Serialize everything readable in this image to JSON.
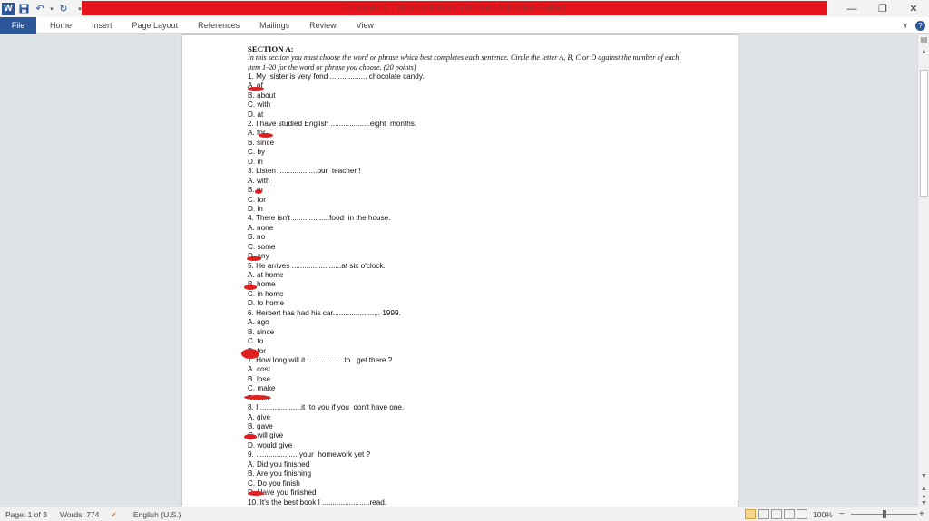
{
  "title_bar": {
    "title": "Document2 - Microsoft Word (Product Activation Failed)",
    "logo_letter": "W",
    "qat": {
      "save": "🖫",
      "undo": "↶",
      "redo": "↻",
      "customize": "▾"
    },
    "controls": {
      "minimize": "—",
      "restore": "❐",
      "close": "✕"
    }
  },
  "ribbon": {
    "tabs": [
      "File",
      "Home",
      "Insert",
      "Page Layout",
      "References",
      "Mailings",
      "Review",
      "View"
    ],
    "help": "?",
    "expand": "∨"
  },
  "document": {
    "heading": "SECTION A:",
    "instructions": "In this section you must choose the word or phrase which best completes each sentence. Circle the letter A, B, C or D against the number of each item 1-20 for the word or phrase you choose. (20 points)",
    "lines": [
      "1. My  sister is very fond .................. chocolate candy.",
      "A. of",
      "B. about",
      "C. with",
      "D. at",
      "2. I have studied English ...................eight  months.",
      "A. for",
      "B. since",
      "C. by",
      "D. in",
      "3. Listen ...................our  teacher !",
      "A. with",
      "B. to",
      "C. for",
      "D. in",
      "4. There isn't ..................food  in the house.",
      "A. none",
      "B. no",
      "C. some",
      "D. any",
      "5. He arrives ........................at six o'clock.",
      "A. at home",
      "B. home",
      "C. in home",
      "D. to home",
      "6. Herbert has had his car....................... 1999.",
      "A. ago",
      "B. since",
      "C. to",
      "D. for",
      "7. How long will it ..................to   get there ?",
      "A. cost",
      "B. lose",
      "C. make",
      "D. take",
      "8. I ....................it  to you if you  don't have one.",
      "A. give",
      "B. gave",
      "C. will give",
      "D. would give",
      "9. .....................your  homework yet ?",
      "A. Did you finished",
      "B. Are you finishing",
      "C. Do you finish",
      "D. Have you finished",
      "10. It's the best book I .......................read."
    ]
  },
  "status_bar": {
    "page": "Page: 1 of 3",
    "words": "Words: 774",
    "language": "English (U.S.)",
    "zoom": "100%",
    "zoom_minus": "−",
    "zoom_plus": "+",
    "zoom_level": 0.5
  },
  "colors": {
    "title_accent": "#e8141b",
    "file_tab": "#2b579a",
    "annotation_marks": "#e02020"
  }
}
